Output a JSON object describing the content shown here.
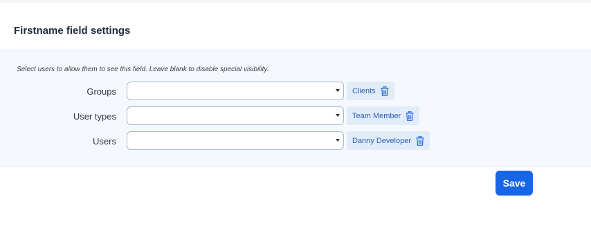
{
  "panel": {
    "title": "Firstname field settings"
  },
  "visibility": {
    "hint": "Select users to allow them to see this field. Leave blank to disable special visibility.",
    "rows": [
      {
        "label": "Groups",
        "selected_tags": [
          "Clients"
        ]
      },
      {
        "label": "User types",
        "selected_tags": [
          "Team Member"
        ]
      },
      {
        "label": "Users",
        "selected_tags": [
          "Danny Developer"
        ]
      }
    ]
  },
  "footer": {
    "save_label": "Save"
  },
  "colors": {
    "accent": "#1766e8",
    "tag_bg": "#e2ecf9",
    "tag_text": "#2a5fb5",
    "section_bg": "#f5f9fd"
  },
  "icons": {
    "remove_tag": "trash-icon",
    "dropdown": "chevron-down-icon"
  }
}
